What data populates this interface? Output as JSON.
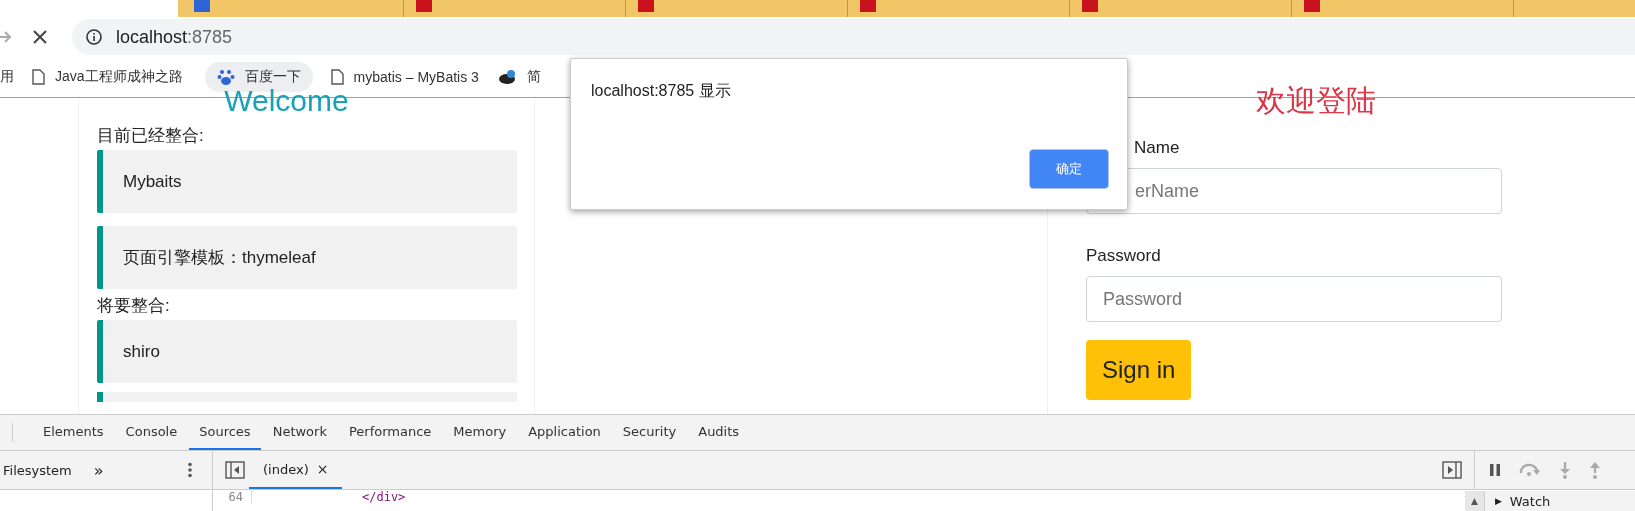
{
  "browser": {
    "tabs": [
      {
        "kind": "baidu"
      },
      {
        "kind": "csdn"
      },
      {
        "kind": "csdn"
      },
      {
        "kind": "csdn"
      },
      {
        "kind": "csdn"
      },
      {
        "kind": "csdn"
      }
    ],
    "address": {
      "host": "localhost",
      "port": ":8785"
    },
    "bookmarks": [
      {
        "kind": "cut",
        "label": "用"
      },
      {
        "kind": "page",
        "label": "Java工程师成神之路"
      },
      {
        "kind": "baidu",
        "label": "百度一下"
      },
      {
        "kind": "page",
        "label": "mybatis – MyBatis 3"
      },
      {
        "kind": "bird",
        "label": "简"
      }
    ]
  },
  "left_panel": {
    "heading": "Welcome",
    "sections": [
      {
        "label": "目前已经整合:",
        "items": [
          "Mybaits",
          "页面引擎模板：thymeleaf"
        ]
      },
      {
        "label": "将要整合:",
        "items": [
          "shiro"
        ]
      }
    ]
  },
  "login_form": {
    "heading": "欢迎登陆",
    "fields": [
      {
        "label": "Name",
        "placeholder": "erName"
      },
      {
        "label": "Password",
        "placeholder": "Password"
      }
    ],
    "submit": "Sign in"
  },
  "dialog": {
    "message": "localhost:8785 显示",
    "button": "确定"
  },
  "devtools": {
    "tabs": [
      {
        "label": "Elements",
        "selected": false
      },
      {
        "label": "Console",
        "selected": false
      },
      {
        "label": "Sources",
        "selected": true
      },
      {
        "label": "Network",
        "selected": false
      },
      {
        "label": "Performance",
        "selected": false
      },
      {
        "label": "Memory",
        "selected": false
      },
      {
        "label": "Application",
        "selected": false
      },
      {
        "label": "Security",
        "selected": false
      },
      {
        "label": "Audits",
        "selected": false
      }
    ],
    "navigator_tab": "Filesystem",
    "more": "»",
    "file_tab": {
      "label": "(index)",
      "close": "×",
      "selected": true
    },
    "code_lines": [
      {
        "number": "64",
        "code": "</div>"
      }
    ],
    "watch": {
      "toggle": "▲",
      "arrow": "▶",
      "label": "Watch"
    }
  }
}
